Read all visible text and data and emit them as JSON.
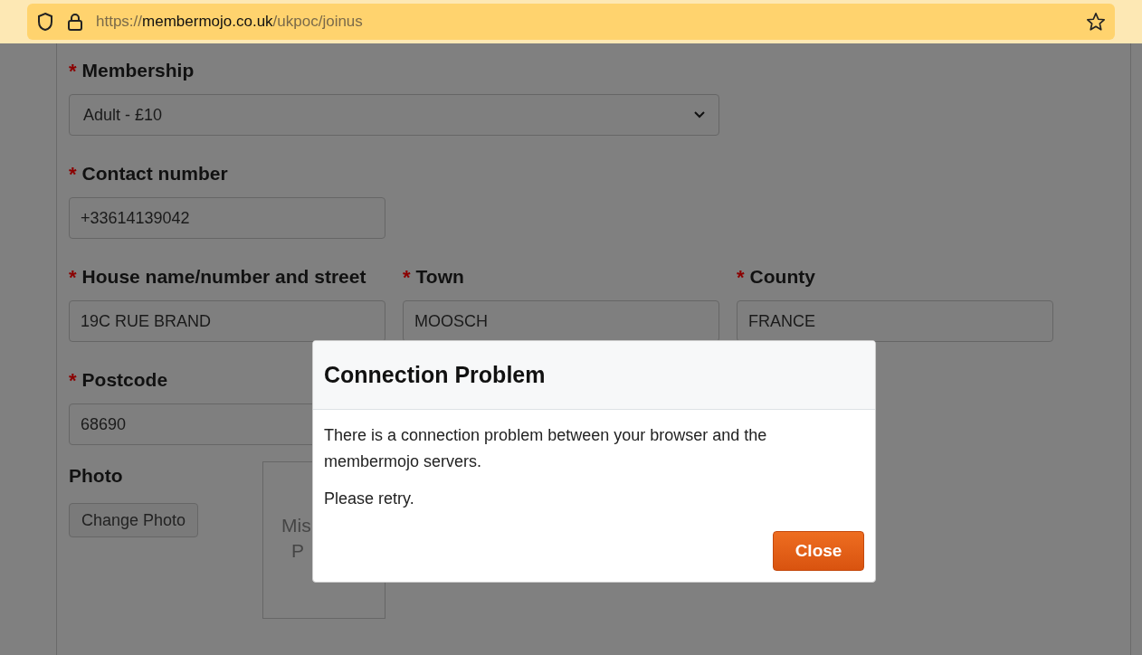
{
  "browser": {
    "url_scheme": "https://",
    "url_host": "membermojo.co.uk",
    "url_path": "/ukpoc/joinus"
  },
  "form": {
    "rows": [
      [
        {
          "kind": "select",
          "required_mark": "*",
          "label": "Membership",
          "value": "Adult - £10"
        }
      ],
      [
        {
          "kind": "text",
          "required_mark": "*",
          "label": "Contact number",
          "value": "+33614139042"
        }
      ],
      [
        {
          "kind": "text",
          "required_mark": "*",
          "label": "House name/number and street",
          "value": "19C RUE BRAND"
        },
        {
          "kind": "text",
          "required_mark": "*",
          "label": "Town",
          "value": "MOOSCH"
        },
        {
          "kind": "text",
          "required_mark": "*",
          "label": "County",
          "value": "FRANCE"
        }
      ],
      [
        {
          "kind": "text",
          "required_mark": "*",
          "label": "Postcode",
          "value": "68690"
        }
      ]
    ],
    "photo": {
      "label": "Photo",
      "button": "Change Photo",
      "placeholder_lines": [
        "Mis",
        "P"
      ]
    }
  },
  "dialog": {
    "title": "Connection Problem",
    "paragraphs": [
      "There is a connection problem between your browser and the membermojo servers.",
      "Please retry."
    ],
    "button": "Close"
  }
}
